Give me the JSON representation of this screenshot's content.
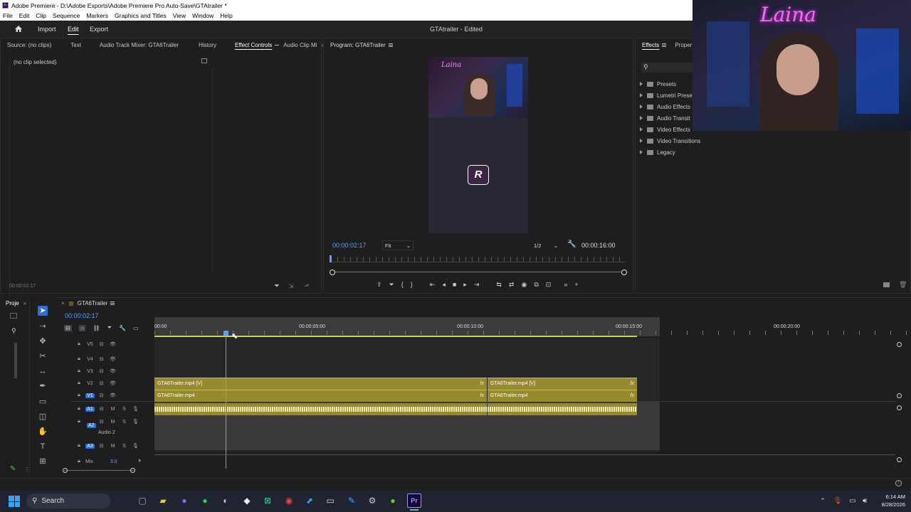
{
  "window": {
    "title": "Adobe Premiere - D:\\Adobe Exports\\Adobe Premiere Pro Auto-Save\\GTAtrailer *"
  },
  "menu": [
    "File",
    "Edit",
    "Clip",
    "Sequence",
    "Markers",
    "Graphics and Titles",
    "View",
    "Window",
    "Help"
  ],
  "header": {
    "import": "Import",
    "edit": "Edit",
    "export": "Export",
    "doc_title": "GTAtrailer - Edited"
  },
  "source_panel": {
    "tabs": [
      "Source: (no clips)",
      "Text",
      "Audio Track Mixer: GTA6Trailer",
      "History",
      "Effect Controls",
      "Audio Clip Mi"
    ],
    "active_tab": "Effect Controls",
    "no_clip": "(no clip selected)",
    "timecode": "00:00:02:17"
  },
  "program_monitor": {
    "tab": "Program: GTA6Trailer",
    "current_timecode": "00:00:02:17",
    "fit": "Fit",
    "resolution": "1/2",
    "duration": "00:00:16:00",
    "overlay_text": "Laina",
    "logo_text": "R"
  },
  "effects_panel": {
    "tabs": [
      "Effects",
      "Propert"
    ],
    "items": [
      "Presets",
      "Lumetri Prese",
      "Audio Effects",
      "Audio Transit",
      "Video Effects",
      "Video Transitions",
      "Legacy"
    ]
  },
  "project_panel": {
    "tab": "Proje"
  },
  "timeline": {
    "sequence_name": "GTA6Trailer",
    "timecode": "00:00:02:17",
    "ruler": [
      "00:00",
      "00:00:05:00",
      "00:00:10:00",
      "00:00:15:00",
      "00:00:20:00"
    ],
    "tracks": {
      "video": [
        "V5",
        "V4",
        "V3",
        "V2",
        "V1"
      ],
      "audio": [
        "A1",
        "A2",
        "A3"
      ],
      "audio2_name": "Audio 2",
      "mix_label": "Mix",
      "mix_value": "3.0"
    },
    "clips": {
      "v_clip1": "GTA6Trailer.mp4 [V]",
      "v_clip2": "GTA6Trailer.mp4 [V]",
      "v1_clip1": "GTA6Trailer.mp4",
      "v1_clip2": "GTA6Trailer.mp4",
      "fx": "fx"
    },
    "track_letters": {
      "mute": "M",
      "solo": "S"
    }
  },
  "webcam": {
    "neon_text": "Laina"
  },
  "taskbar": {
    "search": "Search",
    "time": "6:14 AM",
    "date": "8/28/2026"
  },
  "colors": {
    "accent": "#2a6fdb",
    "clip": "#968a2e",
    "timecode": "#5aa0ff",
    "neon": "#ff66ff"
  }
}
